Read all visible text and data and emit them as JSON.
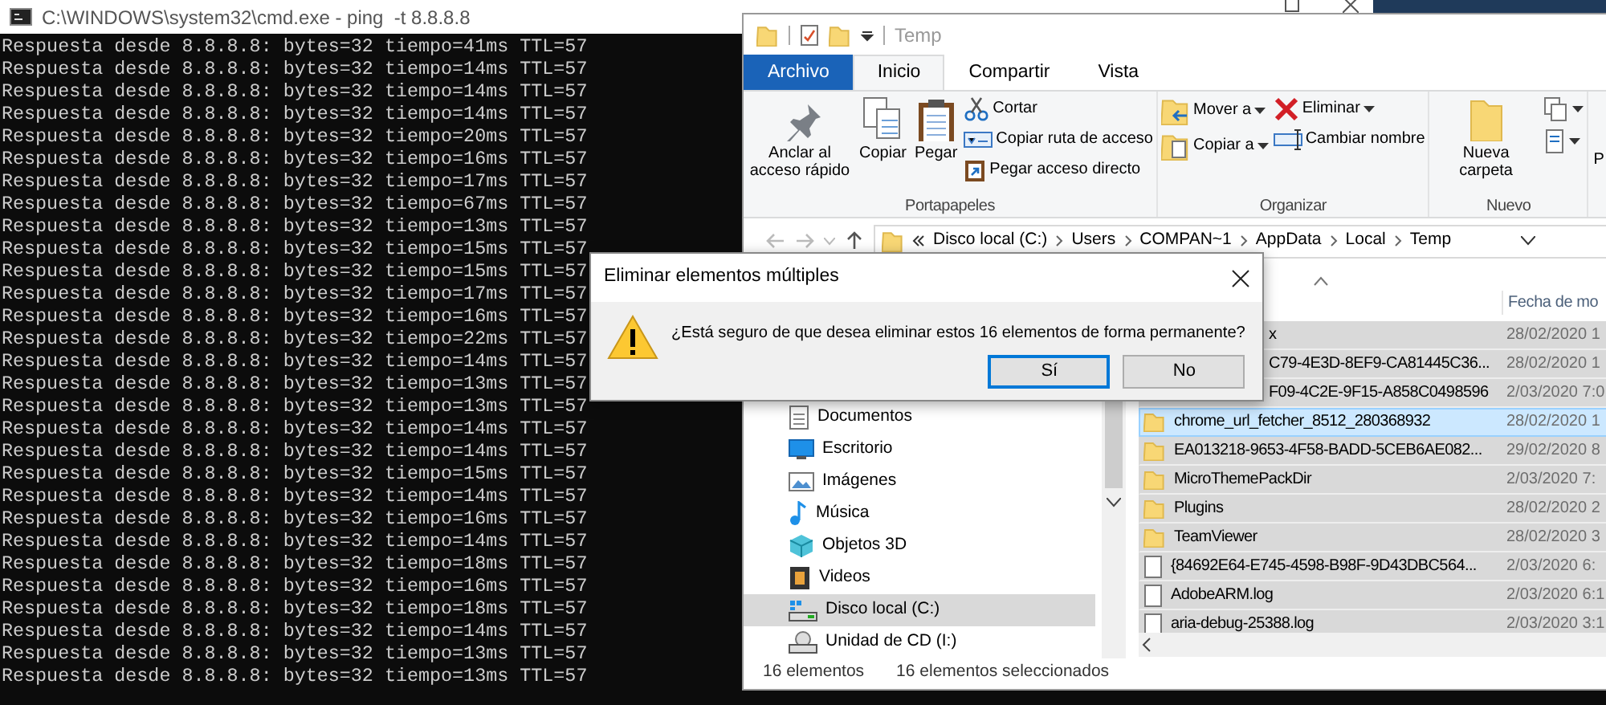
{
  "cmd": {
    "title": "C:\\WINDOWS\\system32\\cmd.exe - ping  -t 8.8.8.8",
    "lines": [
      "Respuesta desde 8.8.8.8: bytes=32 tiempo=41ms TTL=57",
      "Respuesta desde 8.8.8.8: bytes=32 tiempo=14ms TTL=57",
      "Respuesta desde 8.8.8.8: bytes=32 tiempo=14ms TTL=57",
      "Respuesta desde 8.8.8.8: bytes=32 tiempo=14ms TTL=57",
      "Respuesta desde 8.8.8.8: bytes=32 tiempo=20ms TTL=57",
      "Respuesta desde 8.8.8.8: bytes=32 tiempo=16ms TTL=57",
      "Respuesta desde 8.8.8.8: bytes=32 tiempo=17ms TTL=57",
      "Respuesta desde 8.8.8.8: bytes=32 tiempo=67ms TTL=57",
      "Respuesta desde 8.8.8.8: bytes=32 tiempo=13ms TTL=57",
      "Respuesta desde 8.8.8.8: bytes=32 tiempo=15ms TTL=57",
      "Respuesta desde 8.8.8.8: bytes=32 tiempo=15ms TTL=57",
      "Respuesta desde 8.8.8.8: bytes=32 tiempo=17ms TTL=57",
      "Respuesta desde 8.8.8.8: bytes=32 tiempo=16ms TTL=57",
      "Respuesta desde 8.8.8.8: bytes=32 tiempo=22ms TTL=57",
      "Respuesta desde 8.8.8.8: bytes=32 tiempo=14ms TTL=57",
      "Respuesta desde 8.8.8.8: bytes=32 tiempo=13ms TTL=57",
      "Respuesta desde 8.8.8.8: bytes=32 tiempo=13ms TTL=57",
      "Respuesta desde 8.8.8.8: bytes=32 tiempo=14ms TTL=57",
      "Respuesta desde 8.8.8.8: bytes=32 tiempo=14ms TTL=57",
      "Respuesta desde 8.8.8.8: bytes=32 tiempo=15ms TTL=57",
      "Respuesta desde 8.8.8.8: bytes=32 tiempo=14ms TTL=57",
      "Respuesta desde 8.8.8.8: bytes=32 tiempo=16ms TTL=57",
      "Respuesta desde 8.8.8.8: bytes=32 tiempo=14ms TTL=57",
      "Respuesta desde 8.8.8.8: bytes=32 tiempo=18ms TTL=57",
      "Respuesta desde 8.8.8.8: bytes=32 tiempo=16ms TTL=57",
      "Respuesta desde 8.8.8.8: bytes=32 tiempo=18ms TTL=57",
      "Respuesta desde 8.8.8.8: bytes=32 tiempo=14ms TTL=57",
      "Respuesta desde 8.8.8.8: bytes=32 tiempo=13ms TTL=57",
      "Respuesta desde 8.8.8.8: bytes=32 tiempo=13ms TTL=57"
    ]
  },
  "explorer": {
    "title": "Temp",
    "ribbon_tabs": [
      {
        "label": "Archivo",
        "kind": "file",
        "selected": false
      },
      {
        "label": "Inicio",
        "kind": "tab",
        "selected": true
      },
      {
        "label": "Compartir",
        "kind": "tab",
        "selected": false
      },
      {
        "label": "Vista",
        "kind": "tab",
        "selected": false
      }
    ],
    "ribbon_groups": [
      {
        "label": "Portapapeles",
        "columns": [
          [
            {
              "kind": "large",
              "label": "Anclar al acceso rápido"
            }
          ],
          [
            {
              "kind": "large",
              "label": "Copiar"
            }
          ],
          [
            {
              "kind": "large",
              "label": "Pegar"
            }
          ],
          [
            {
              "kind": "small",
              "label": "Cortar"
            },
            {
              "kind": "small",
              "label": "Copiar ruta de acceso"
            },
            {
              "kind": "small",
              "label": "Pegar acceso directo"
            }
          ]
        ]
      },
      {
        "label": "Organizar",
        "columns": [
          [
            {
              "kind": "small",
              "label": "Mover a",
              "dropdown": true
            },
            {
              "kind": "small",
              "label": "Copiar a",
              "dropdown": true
            }
          ],
          [
            {
              "kind": "small",
              "label": "Eliminar",
              "dropdown": true
            },
            {
              "kind": "small",
              "label": "Cambiar nombre",
              "dropdown": false
            }
          ]
        ]
      },
      {
        "label": "Nuevo",
        "columns": [
          [
            {
              "kind": "large",
              "label": "Nueva carpeta"
            }
          ],
          [
            {
              "kind": "icon",
              "dropdown": true
            },
            {
              "kind": "icon",
              "dropdown": true
            }
          ]
        ]
      },
      {
        "columns": [
          [
            {
              "kind": "large",
              "label": "P"
            }
          ]
        ]
      }
    ],
    "address": {
      "crumbs": [
        "Disco local (C:)",
        "Users",
        "COMPAN~1",
        "AppData",
        "Local",
        "Temp"
      ]
    },
    "nav_items": [
      {
        "label": "Documentos",
        "selected": false
      },
      {
        "label": "Escritorio",
        "selected": false
      },
      {
        "label": "Imágenes",
        "selected": false
      },
      {
        "label": "Música",
        "selected": false
      },
      {
        "label": "Objetos 3D",
        "selected": false
      },
      {
        "label": "Videos",
        "selected": false
      },
      {
        "label": "Disco local (C:)",
        "selected": true
      },
      {
        "label": "Unidad de CD (I:)",
        "selected": false
      }
    ],
    "columns": [
      {
        "sorted": true
      },
      {
        "label": "Fecha de mo",
        "sorted": false
      }
    ],
    "files": [
      {
        "kind": "partial",
        "name": "x",
        "date": "28/02/2020 1",
        "selected": true,
        "highlighted": false
      },
      {
        "kind": "partial",
        "name": "C79-4E3D-8EF9-CA81445C36...",
        "date": "28/02/2020 1",
        "selected": true,
        "highlighted": false
      },
      {
        "kind": "partial",
        "name": "F09-4C2E-9F15-A858C0498596",
        "date": "2/03/2020 7:0",
        "selected": true,
        "highlighted": false
      },
      {
        "kind": "folder",
        "name": "chrome_url_fetcher_8512_280368932",
        "date": "28/02/2020 1",
        "selected": true,
        "highlighted": true
      },
      {
        "kind": "folder",
        "name": "EA013218-9653-4F58-BADD-5CEB6AE082...",
        "date": "29/02/2020 8",
        "selected": true,
        "highlighted": false
      },
      {
        "kind": "folder",
        "name": "MicroThemePackDir",
        "date": "2/03/2020 7:",
        "selected": true,
        "highlighted": false
      },
      {
        "kind": "folder",
        "name": "Plugins",
        "date": "28/02/2020 2",
        "selected": true,
        "highlighted": false
      },
      {
        "kind": "folder",
        "name": "TeamViewer",
        "date": "28/02/2020 3",
        "selected": true,
        "highlighted": false
      },
      {
        "kind": "file",
        "name": "{84692E64-E745-4598-B98F-9D43DBC564...",
        "date": "2/03/2020 6:",
        "selected": true,
        "highlighted": false
      },
      {
        "kind": "file",
        "name": "AdobeARM.log",
        "date": "2/03/2020 6:1",
        "selected": true,
        "highlighted": false
      },
      {
        "kind": "file",
        "name": "aria-debug-25388.log",
        "date": "2/03/2020 3:1",
        "selected": true,
        "highlighted": false
      }
    ],
    "status": [
      "16 elementos",
      "16 elementos seleccionados"
    ]
  },
  "dialog": {
    "title": "Eliminar elementos múltiples",
    "message": "¿Está seguro de que desea eliminar estos 16 elementos de forma permanente?",
    "buttons": [
      {
        "label": "Sí",
        "default": true
      },
      {
        "label": "No",
        "default": false
      }
    ]
  }
}
